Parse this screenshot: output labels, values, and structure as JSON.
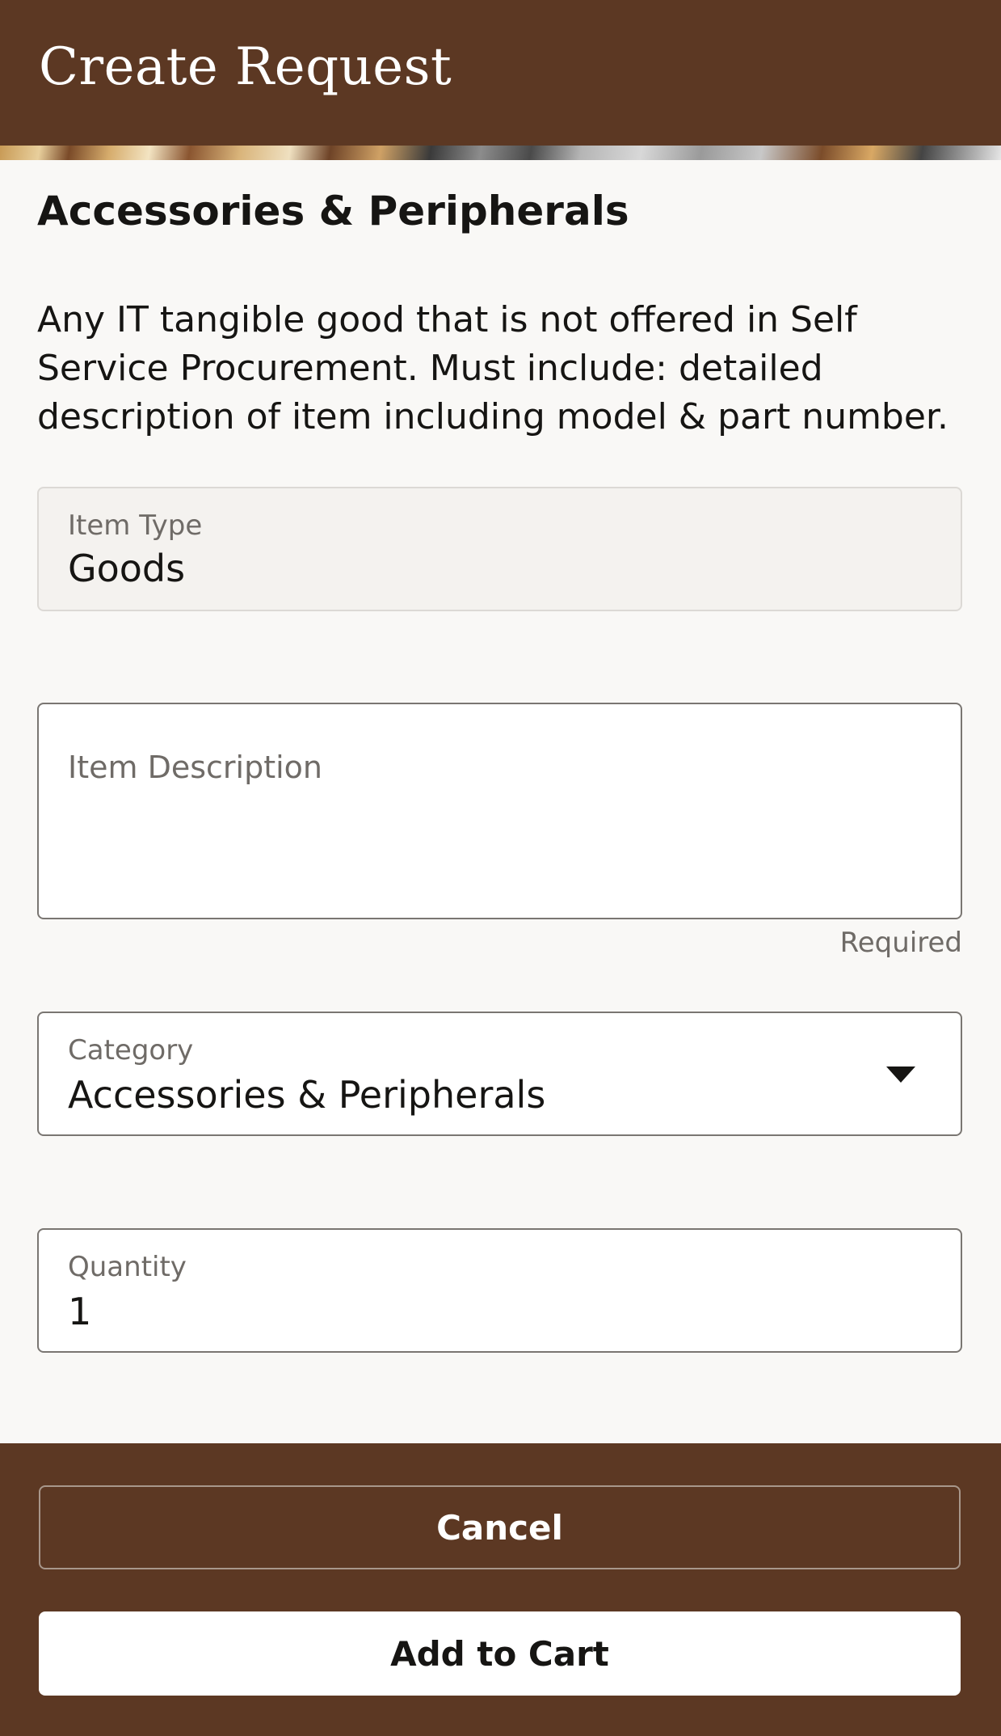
{
  "header": {
    "title": "Create Request"
  },
  "section": {
    "title": "Accessories & Peripherals",
    "description": "Any IT tangible good that is not offered in Self Service Procurement. Must include: detailed description of item including model & part number."
  },
  "fields": {
    "item_type": {
      "label": "Item Type",
      "value": "Goods"
    },
    "item_description": {
      "label": "Item Description",
      "value": "",
      "helper": "Required"
    },
    "category": {
      "label": "Category",
      "value": "Accessories & Peripherals"
    },
    "quantity": {
      "label": "Quantity",
      "value": "1"
    }
  },
  "footer": {
    "cancel_label": "Cancel",
    "add_label": "Add to Cart"
  },
  "colors": {
    "brand": "#5c3823",
    "text": "#161513",
    "muted": "#6f6b67"
  }
}
